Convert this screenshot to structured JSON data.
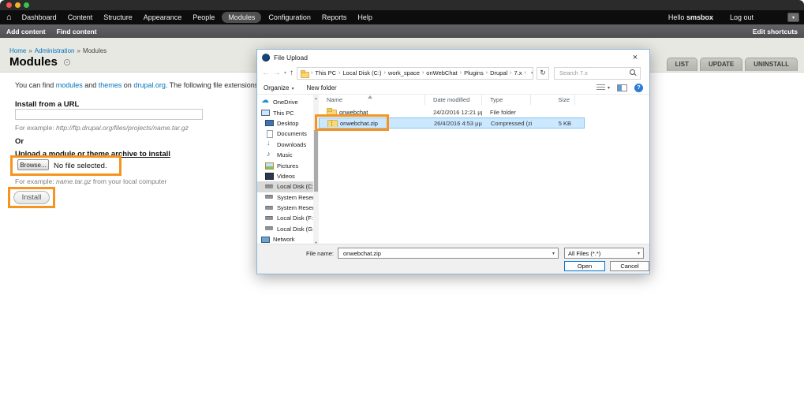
{
  "colors": {
    "annotation": "#f7941e",
    "selection_fill": "#cce8ff",
    "accent": "#0078d7",
    "link": "#0074bd"
  },
  "admin_toolbar": {
    "home_icon": "⌂",
    "items": [
      "Dashboard",
      "Content",
      "Structure",
      "Appearance",
      "People",
      "Modules",
      "Configuration",
      "Reports",
      "Help"
    ],
    "active_item": "Modules",
    "greeting": "Hello",
    "username": "smsbox",
    "logout": "Log out",
    "caret": "▾"
  },
  "shortcut_bar": {
    "add_content": "Add content",
    "find_content": "Find content",
    "edit_shortcuts": "Edit shortcuts"
  },
  "page": {
    "breadcrumb": {
      "home": "Home",
      "admin": "Administration",
      "modules": "Modules",
      "sep": "»"
    },
    "title": "Modules",
    "tabs": [
      "LIST",
      "UPDATE",
      "UNINSTALL"
    ],
    "intro": {
      "pre": "You can find ",
      "link_modules": "modules",
      "and": " and ",
      "link_themes": "themes",
      "on": " on ",
      "link_drupal": "drupal.org",
      "post": ". The following file extensions are suppor"
    },
    "form": {
      "url_label": "Install from a URL",
      "url_example_label": "For example: ",
      "url_example_value": "http://ftp.drupal.org/files/projects/name.tar.gz",
      "or": "Or",
      "upload_label": "Upload a module or theme archive to install",
      "browse": "Browse...",
      "no_file": "No file selected.",
      "upload_example_label": "For example: ",
      "upload_example_file": "name.tar.gz",
      "upload_example_post": " from your local computer",
      "install": "Install"
    }
  },
  "dialog": {
    "title": "File Upload",
    "close": "×",
    "nav": {
      "back": "←",
      "forward": "→",
      "up": "↑",
      "caret": "▾",
      "refresh": "↻"
    },
    "address": {
      "sep": "›",
      "segments": [
        "This PC",
        "Local Disk (C:)",
        "work_space",
        "onWebChat",
        "Plugins",
        "Drupal",
        "7.x"
      ]
    },
    "search_placeholder": "Search 7.x",
    "toolbar": {
      "organize": "Organize",
      "new_folder": "New folder",
      "help": "?"
    },
    "sidebar": {
      "scroll_up": "▲",
      "scroll_down": "▼",
      "items": [
        {
          "label": "OneDrive"
        },
        {
          "label": "This PC"
        },
        {
          "label": "Desktop"
        },
        {
          "label": "Documents"
        },
        {
          "label": "Downloads"
        },
        {
          "label": "Music"
        },
        {
          "label": "Pictures"
        },
        {
          "label": "Videos"
        },
        {
          "label": "Local Disk (C:)"
        },
        {
          "label": "System Reserved"
        },
        {
          "label": "System Reserved"
        },
        {
          "label": "Local Disk (F:)"
        },
        {
          "label": "Local Disk (G:)"
        },
        {
          "label": "Network"
        }
      ],
      "selected": "Local Disk (C:)"
    },
    "columns": {
      "name": "Name",
      "date": "Date modified",
      "type": "Type",
      "size": "Size"
    },
    "files": [
      {
        "name": "onwebchat",
        "date": "24/2/2016 12:21 μμ",
        "type": "File folder",
        "size": ""
      },
      {
        "name": "onwebchat.zip",
        "date": "26/4/2016 4:53 μμ",
        "type": "Compressed (zipp...",
        "size": "5 KB"
      }
    ],
    "selected_file": "onwebchat.zip",
    "footer": {
      "file_name_label": "File name:",
      "file_name_value": "onwebchat.zip",
      "filter_value": "All Files (*.*)",
      "open": "Open",
      "cancel": "Cancel"
    }
  }
}
